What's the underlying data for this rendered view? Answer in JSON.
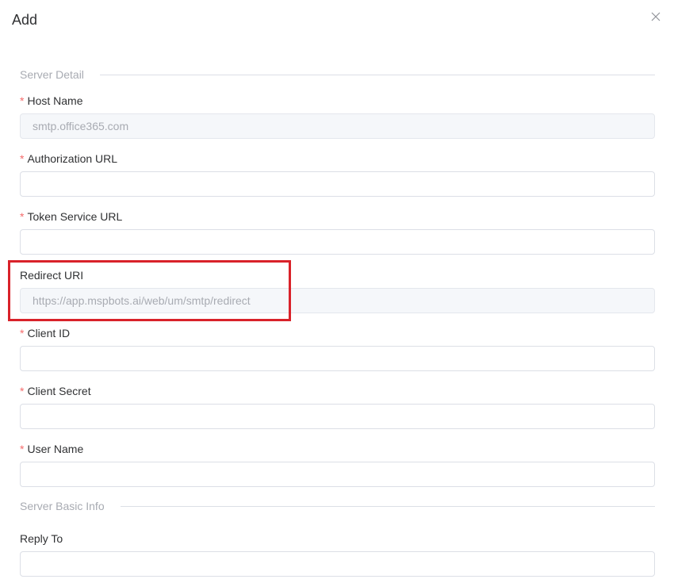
{
  "dialog": {
    "title": "Add",
    "close_icon": "close-icon"
  },
  "sections": {
    "server_detail": "Server Detail",
    "server_basic_info": "Server Basic Info"
  },
  "fields": {
    "host_name": {
      "label": "Host Name",
      "required": true,
      "value": "smtp.office365.com",
      "disabled": true
    },
    "authorization_url": {
      "label": "Authorization URL",
      "required": true,
      "value": ""
    },
    "token_service_url": {
      "label": "Token Service URL",
      "required": true,
      "value": ""
    },
    "redirect_uri": {
      "label": "Redirect URI",
      "required": false,
      "value": "https://app.mspbots.ai/web/um/smtp/redirect",
      "disabled": true
    },
    "client_id": {
      "label": "Client ID",
      "required": true,
      "value": ""
    },
    "client_secret": {
      "label": "Client Secret",
      "required": true,
      "value": ""
    },
    "user_name": {
      "label": "User Name",
      "required": true,
      "value": ""
    },
    "reply_to": {
      "label": "Reply To",
      "required": false,
      "value": ""
    }
  },
  "required_mark": "*",
  "highlight_color": "#d9222a"
}
